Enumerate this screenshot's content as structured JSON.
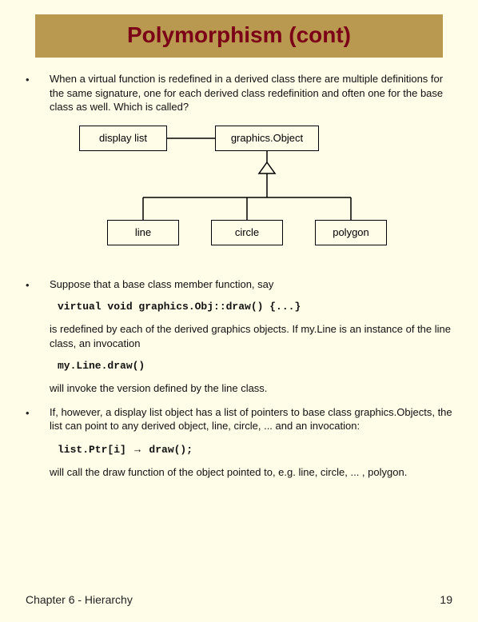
{
  "title": "Polymorphism (cont)",
  "bullets": {
    "b1": "When a virtual function is redefined in a derived class there are multiple definitions for the same signature, one for each derived class redefinition and often one for the base class as well.  Which is called?",
    "b2": "Suppose that a base class member function, say",
    "b2_after1": "is redefined by each of the derived graphics objects.  If my.Line is an instance of the line class, an invocation",
    "b2_after2": "will invoke the version defined by the line class.",
    "b3": "If, however, a display list object has a list of pointers to base class graphics.Objects, the list can point to any derived object, line, circle, ... and an invocation:",
    "b3_after": "will call the draw function of the object pointed to, e.g. line, circle, ... , polygon."
  },
  "diagram": {
    "display_list": "display list",
    "graphics_object": "graphics.Object",
    "line": "line",
    "circle": "circle",
    "polygon": "polygon"
  },
  "code": {
    "c1": "virtual void graphics.Obj::draw() {...}",
    "c2": "my.Line.draw()",
    "c3a": "list.Ptr[i] ",
    "c3arrow": "→",
    "c3b": " draw();"
  },
  "footer": {
    "chapter": "Chapter 6 - Hierarchy",
    "page": "19"
  }
}
